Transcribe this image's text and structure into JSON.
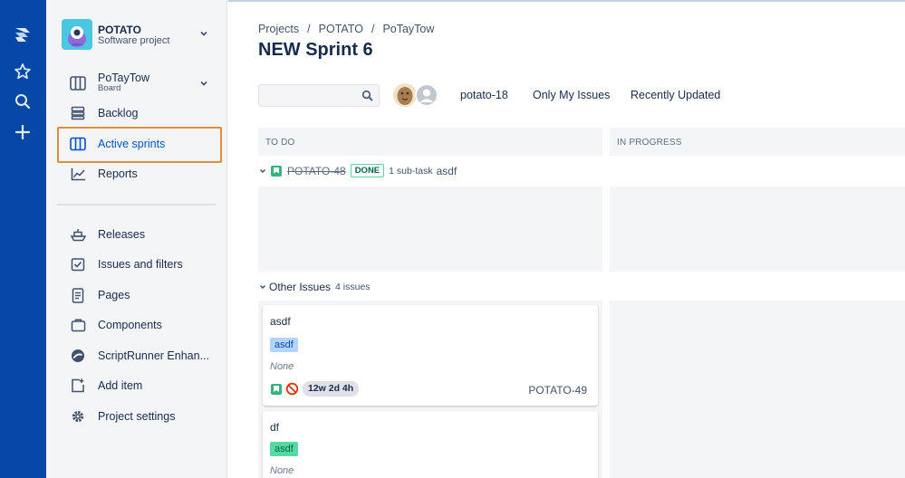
{
  "project": {
    "name": "POTATO",
    "type": "Software project"
  },
  "board_selector": {
    "name": "PoTayTow",
    "sub": "Board"
  },
  "nav": [
    {
      "label": "Backlog",
      "icon": "backlog-icon"
    },
    {
      "label": "Active sprints",
      "icon": "board-columns-icon",
      "active": true
    },
    {
      "label": "Reports",
      "icon": "chart-line-icon"
    }
  ],
  "nav2": [
    {
      "label": "Releases",
      "icon": "ship-icon"
    },
    {
      "label": "Issues and filters",
      "icon": "issues-icon"
    },
    {
      "label": "Pages",
      "icon": "page-icon"
    },
    {
      "label": "Components",
      "icon": "component-icon"
    },
    {
      "label": "ScriptRunner Enhan...",
      "icon": "scriptrunner-icon"
    },
    {
      "label": "Add item",
      "icon": "add-item-icon"
    },
    {
      "label": "Project settings",
      "icon": "gear-icon"
    }
  ],
  "breadcrumbs": [
    "Projects",
    "POTATO",
    "PoTayTow"
  ],
  "breadcrumb_sep": "/",
  "page_title": "NEW Sprint 6",
  "quick_filters": [
    "potato-18",
    "Only My Issues",
    "Recently Updated"
  ],
  "columns": [
    "TO DO",
    "IN PROGRESS"
  ],
  "swimlane_parent": {
    "key": "POTATO-48",
    "status": "DONE",
    "subtasks": "1 sub-task",
    "summary": "asdf"
  },
  "swimlane_other": {
    "label": "Other Issues",
    "count": "4 issues"
  },
  "cards": [
    {
      "title": "asdf",
      "label": "asdf",
      "assignee": "None",
      "estimate": "12w 2d 4h",
      "key": "POTATO-49"
    },
    {
      "title": "df",
      "label": "asdf",
      "assignee": "None"
    }
  ],
  "colors": {
    "global_nav": "#0747a6",
    "accent": "#0052cc",
    "highlight_border": "#e68a3c",
    "label_blue": "#b3d4ff",
    "label_green": "#57d9a3"
  }
}
